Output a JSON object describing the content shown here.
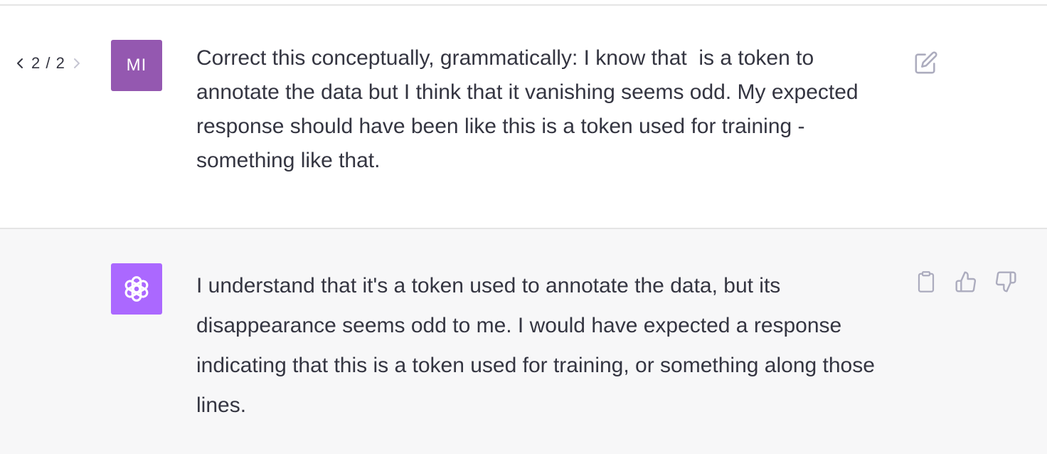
{
  "pager": {
    "label": "2 / 2",
    "prev_icon": "chevron-left-icon",
    "next_icon": "chevron-right-icon"
  },
  "user_message": {
    "avatar_initials": "MI",
    "avatar_color": "#9458b0",
    "text": "Correct this conceptually, grammatically: I know that  is a token to annotate the data but I think that it vanishing seems odd. My expected response should have been like this is a token used for training - something like that.",
    "edit_icon": "edit-icon"
  },
  "assistant_message": {
    "avatar_icon": "openai-logo-icon",
    "avatar_color": "#ab68ff",
    "text": "I understand that it's a token used to annotate the data, but its disappearance seems odd to me. I would have expected a response indicating that this is a token used for training, or something along those lines.",
    "actions": {
      "copy_icon": "clipboard-icon",
      "like_icon": "thumbs-up-icon",
      "dislike_icon": "thumbs-down-icon"
    }
  },
  "colors": {
    "text": "#343541",
    "assistant_bg": "#f7f7f8",
    "divider": "#e5e5e5",
    "icon": "#acacbe"
  }
}
